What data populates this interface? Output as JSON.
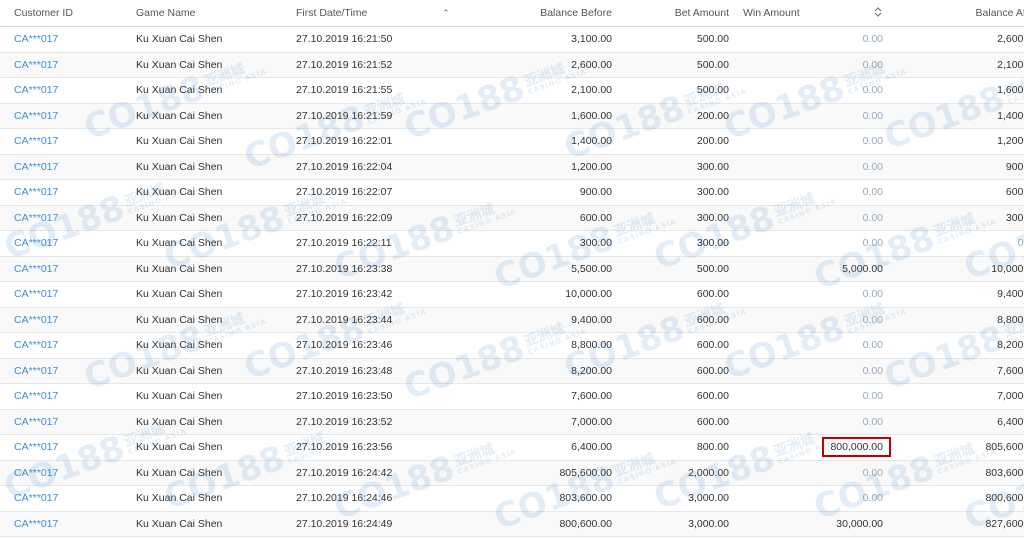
{
  "columns": {
    "customer_id": "Customer ID",
    "game_name": "Game Name",
    "first_date": "First Date/Time",
    "balance_before": "Balance Before",
    "bet_amount": "Bet Amount",
    "win_amount": "Win Amount",
    "balance_after": "Balance After"
  },
  "sort": {
    "first_date": "ascending",
    "win_amount": "unsorted"
  },
  "watermark": {
    "logo": "CO188",
    "chinese": "亚洲城",
    "subtitle": "CASINO ASIA"
  },
  "colors": {
    "link": "#3b8ddb",
    "zero_value": "#9aa9b8",
    "highlight_border": "#c00000"
  },
  "highlighted_row": 16,
  "rows": [
    {
      "customer_id": "CA***017",
      "game": "Ku Xuan Cai Shen",
      "date": "27.10.2019 16:21:50",
      "before": "3,100.00",
      "bet": "500.00",
      "win": "0.00",
      "after": "2,600.00"
    },
    {
      "customer_id": "CA***017",
      "game": "Ku Xuan Cai Shen",
      "date": "27.10.2019 16:21:52",
      "before": "2,600.00",
      "bet": "500.00",
      "win": "0.00",
      "after": "2,100.00"
    },
    {
      "customer_id": "CA***017",
      "game": "Ku Xuan Cai Shen",
      "date": "27.10.2019 16:21:55",
      "before": "2,100.00",
      "bet": "500.00",
      "win": "0.00",
      "after": "1,600.00"
    },
    {
      "customer_id": "CA***017",
      "game": "Ku Xuan Cai Shen",
      "date": "27.10.2019 16:21:59",
      "before": "1,600.00",
      "bet": "200.00",
      "win": "0.00",
      "after": "1,400.00"
    },
    {
      "customer_id": "CA***017",
      "game": "Ku Xuan Cai Shen",
      "date": "27.10.2019 16:22:01",
      "before": "1,400.00",
      "bet": "200.00",
      "win": "0.00",
      "after": "1,200.00"
    },
    {
      "customer_id": "CA***017",
      "game": "Ku Xuan Cai Shen",
      "date": "27.10.2019 16:22:04",
      "before": "1,200.00",
      "bet": "300.00",
      "win": "0.00",
      "after": "900.00"
    },
    {
      "customer_id": "CA***017",
      "game": "Ku Xuan Cai Shen",
      "date": "27.10.2019 16:22:07",
      "before": "900.00",
      "bet": "300.00",
      "win": "0.00",
      "after": "600.00"
    },
    {
      "customer_id": "CA***017",
      "game": "Ku Xuan Cai Shen",
      "date": "27.10.2019 16:22:09",
      "before": "600.00",
      "bet": "300.00",
      "win": "0.00",
      "after": "300.00"
    },
    {
      "customer_id": "CA***017",
      "game": "Ku Xuan Cai Shen",
      "date": "27.10.2019 16:22:11",
      "before": "300.00",
      "bet": "300.00",
      "win": "0.00",
      "after": "0.00"
    },
    {
      "customer_id": "CA***017",
      "game": "Ku Xuan Cai Shen",
      "date": "27.10.2019 16:23:38",
      "before": "5,500.00",
      "bet": "500.00",
      "win": "5,000.00",
      "after": "10,000.00"
    },
    {
      "customer_id": "CA***017",
      "game": "Ku Xuan Cai Shen",
      "date": "27.10.2019 16:23:42",
      "before": "10,000.00",
      "bet": "600.00",
      "win": "0.00",
      "after": "9,400.00"
    },
    {
      "customer_id": "CA***017",
      "game": "Ku Xuan Cai Shen",
      "date": "27.10.2019 16:23:44",
      "before": "9,400.00",
      "bet": "600.00",
      "win": "0.00",
      "after": "8,800.00"
    },
    {
      "customer_id": "CA***017",
      "game": "Ku Xuan Cai Shen",
      "date": "27.10.2019 16:23:46",
      "before": "8,800.00",
      "bet": "600.00",
      "win": "0.00",
      "after": "8,200.00"
    },
    {
      "customer_id": "CA***017",
      "game": "Ku Xuan Cai Shen",
      "date": "27.10.2019 16:23:48",
      "before": "8,200.00",
      "bet": "600.00",
      "win": "0.00",
      "after": "7,600.00"
    },
    {
      "customer_id": "CA***017",
      "game": "Ku Xuan Cai Shen",
      "date": "27.10.2019 16:23:50",
      "before": "7,600.00",
      "bet": "600.00",
      "win": "0.00",
      "after": "7,000.00"
    },
    {
      "customer_id": "CA***017",
      "game": "Ku Xuan Cai Shen",
      "date": "27.10.2019 16:23:52",
      "before": "7,000.00",
      "bet": "600.00",
      "win": "0.00",
      "after": "6,400.00"
    },
    {
      "customer_id": "CA***017",
      "game": "Ku Xuan Cai Shen",
      "date": "27.10.2019 16:23:56",
      "before": "6,400.00",
      "bet": "800.00",
      "win": "800,000.00",
      "after": "805,600.00"
    },
    {
      "customer_id": "CA***017",
      "game": "Ku Xuan Cai Shen",
      "date": "27.10.2019 16:24:42",
      "before": "805,600.00",
      "bet": "2,000.00",
      "win": "0.00",
      "after": "803,600.00"
    },
    {
      "customer_id": "CA***017",
      "game": "Ku Xuan Cai Shen",
      "date": "27.10.2019 16:24:46",
      "before": "803,600.00",
      "bet": "3,000.00",
      "win": "0.00",
      "after": "800,600.00"
    },
    {
      "customer_id": "CA***017",
      "game": "Ku Xuan Cai Shen",
      "date": "27.10.2019 16:24:49",
      "before": "800,600.00",
      "bet": "3,000.00",
      "win": "30,000.00",
      "after": "827,600.00"
    }
  ]
}
